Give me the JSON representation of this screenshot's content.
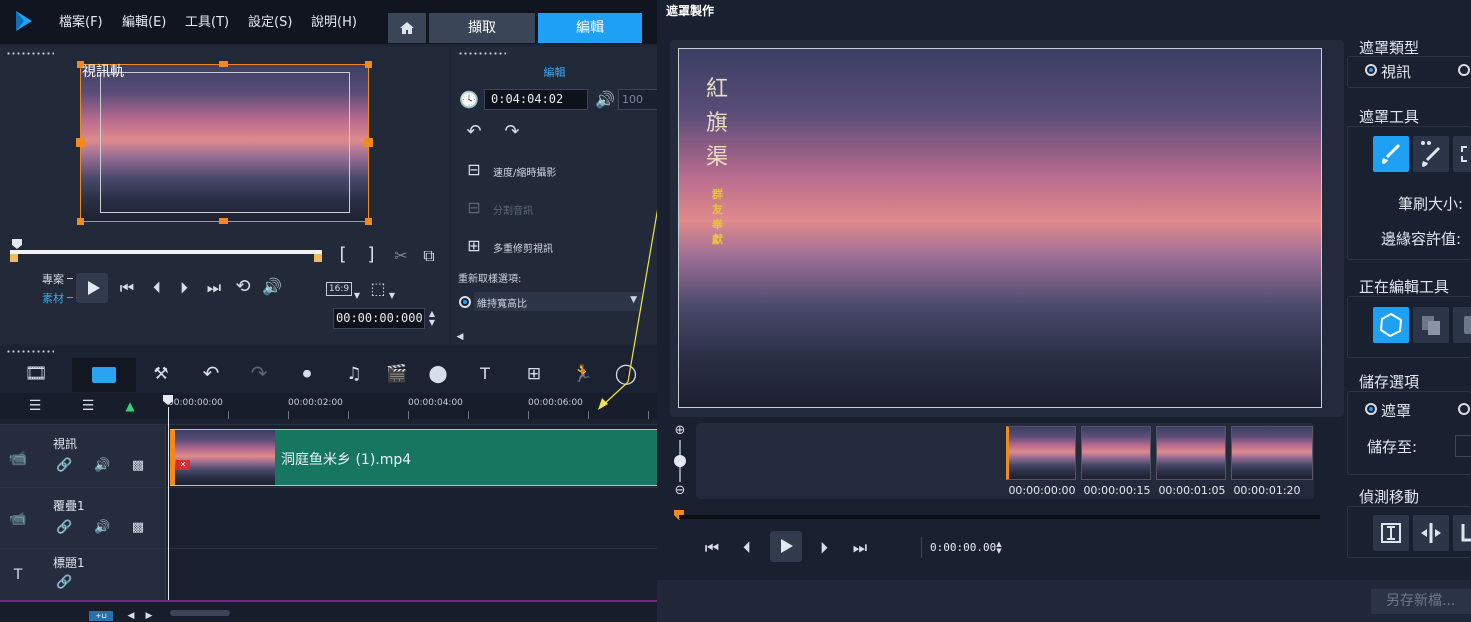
{
  "menu": [
    "檔案(F)",
    "編輯(E)",
    "工具(T)",
    "設定(S)",
    "說明(H)"
  ],
  "tabs": {
    "capture": "擷取",
    "edit": "編輯"
  },
  "preview": {
    "label": "視訊軌"
  },
  "player": {
    "project": "專案",
    "clip": "素材",
    "aspect": "16:9",
    "timecode": "00:00:00:000"
  },
  "options": {
    "header": "編輯",
    "duration": "0:04:04:02",
    "volume": "100",
    "speed": "速度/縮時攝影",
    "split": "分割音訊",
    "multitrim": "多重修剪視訊",
    "resample": "重新取樣選項:",
    "resample_value": "維持寬高比"
  },
  "ruler": [
    "00:00:00:00",
    "00:00:02:00",
    "00:00:04:00",
    "00:00:06:00"
  ],
  "tracks": [
    {
      "name": "視訊",
      "clip": "洞庭鱼米乡 (1).mp4"
    },
    {
      "name": "覆疊1"
    },
    {
      "name": "標題1"
    }
  ],
  "dialog": {
    "title": "遮罩製作",
    "mask_type": "遮罩類型",
    "type_video": "視訊",
    "mask_tools": "遮罩工具",
    "brush_size": "筆刷大小:",
    "edge_tol": "邊緣容許值:",
    "editing_tools": "正在編輯工具",
    "save_options": "儲存選項",
    "save_mask": "遮罩",
    "save_to": "儲存至:",
    "detect": "偵測移動",
    "save_new": "另存新檔...",
    "timecode": "0:00:00.00",
    "frames": [
      "00:00:00:00",
      "00:00:00:15",
      "00:00:01:05",
      "00:00:01:20"
    ]
  },
  "overlay_text": {
    "title": "紅旗渠",
    "sub": "群友奉獻"
  },
  "colors": {
    "accent": "#1ea0f5",
    "clip": "#16765f",
    "orange": "#f08a1c"
  }
}
